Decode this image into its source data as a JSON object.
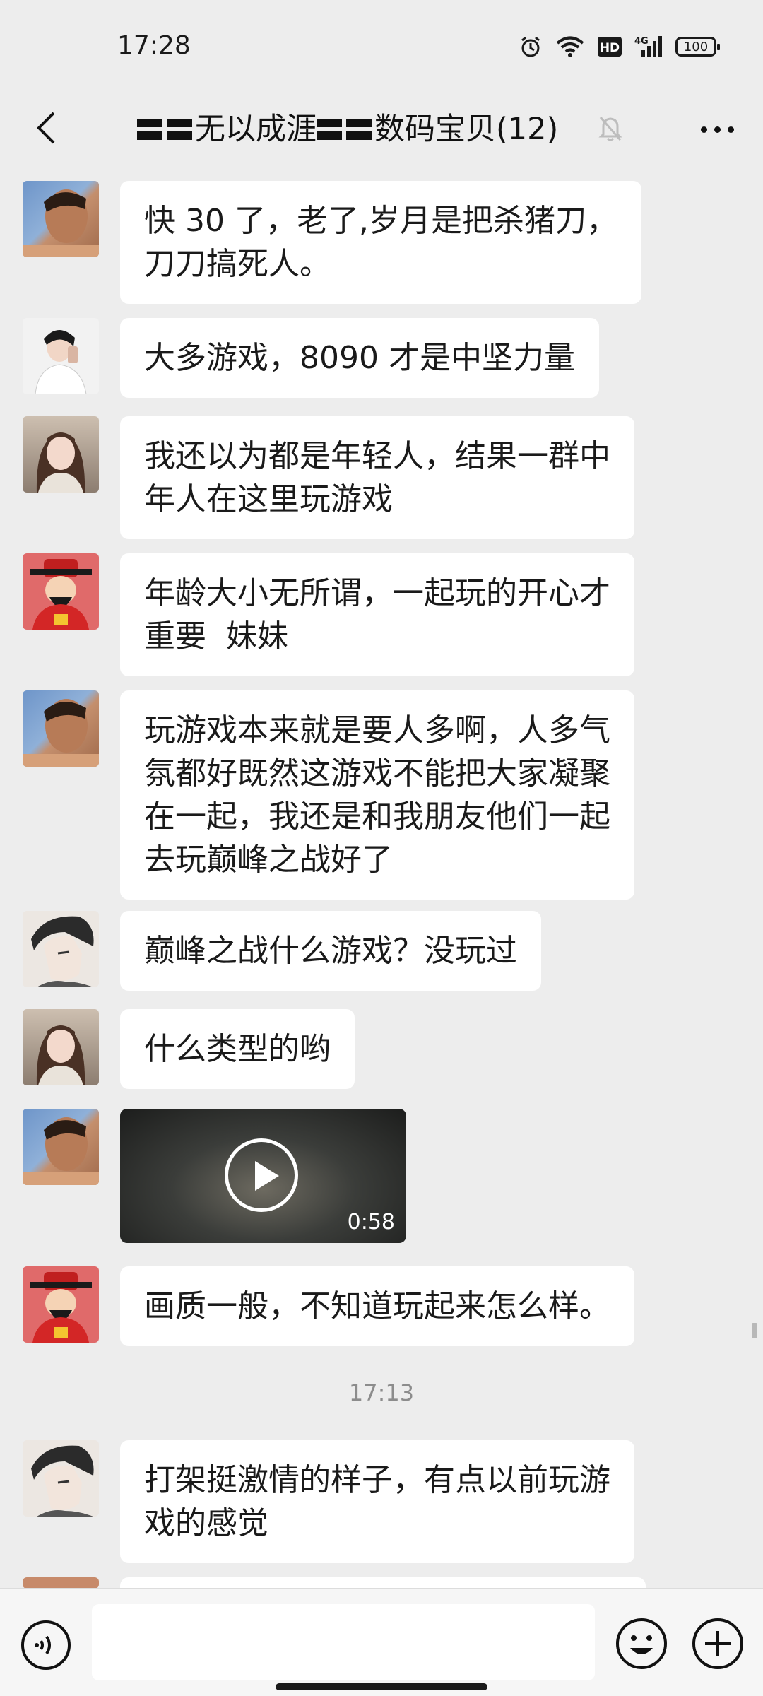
{
  "status_bar": {
    "time": "17:28",
    "battery": "100"
  },
  "header": {
    "title": "无以成涯",
    "title2": "数码宝贝(12)",
    "back_icon": "chevron-left-icon",
    "mute_icon": "bell-off-icon",
    "more_icon": "more-dots-icon"
  },
  "messages": [
    {
      "sender_avatar": "avatar-man-1",
      "text": "快 30 了，老了,岁月是把杀猪刀，\n刀刀搞死人。"
    },
    {
      "sender_avatar": "avatar-man-2",
      "text": "大多游戏，8090 才是中坚力量"
    },
    {
      "sender_avatar": "avatar-woman",
      "text": "我还以为都是年轻人，结果一群中\n年人在这里玩游戏"
    },
    {
      "sender_avatar": "avatar-god-of-wealth",
      "text": "年龄大小无所谓，一起玩的开心才\n重要  妹妹"
    },
    {
      "sender_avatar": "avatar-man-1",
      "text": "玩游戏本来就是要人多啊，人多气\n氛都好既然这游戏不能把大家凝聚\n在一起，我还是和我朋友他们一起\n去玩巅峰之战好了"
    },
    {
      "sender_avatar": "avatar-anime-man",
      "text": "巅峰之战什么游戏？没玩过"
    },
    {
      "sender_avatar": "avatar-woman",
      "text": "什么类型的哟"
    },
    {
      "sender_avatar": "avatar-man-1",
      "video_duration": "0:58"
    },
    {
      "sender_avatar": "avatar-god-of-wealth",
      "text": "画质一般，不知道玩起来怎么样。"
    },
    {
      "sender_avatar": "avatar-anime-man",
      "text": "打架挺激情的样子，有点以前玩游\n戏的感觉"
    }
  ],
  "timestamp": "17:13",
  "input_bar": {
    "voice_icon": "voice-icon",
    "emoji_icon": "emoji-icon",
    "plus_icon": "plus-icon",
    "value": ""
  },
  "colors": {
    "background": "#ededed",
    "bubble": "#ffffff",
    "text": "#1a1a1a"
  }
}
